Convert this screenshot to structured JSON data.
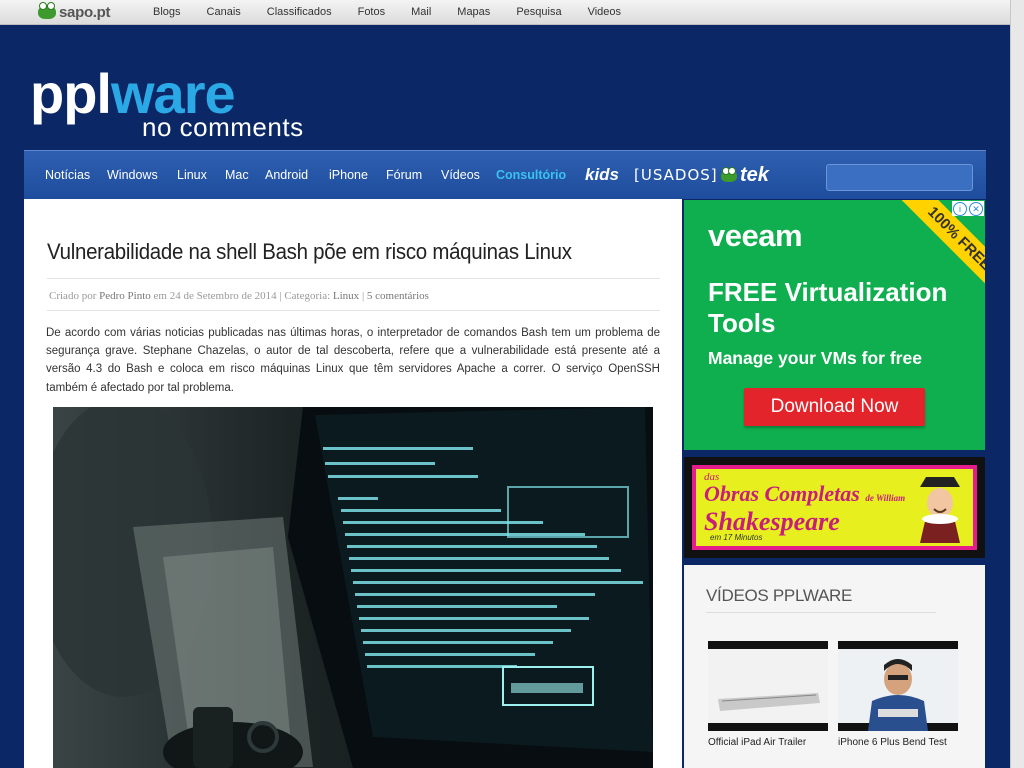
{
  "sapo": {
    "logo_text": "sapo.pt",
    "nav": [
      "Blogs",
      "Canais",
      "Classificados",
      "Fotos",
      "Mail",
      "Mapas",
      "Pesquisa",
      "Videos"
    ]
  },
  "site": {
    "logo_ppl": "ppl",
    "logo_ware": "ware",
    "tagline": "no comments"
  },
  "nav": {
    "items": [
      "Notícias",
      "Windows",
      "Linux",
      "Mac",
      "Android",
      "iPhone",
      "Fórum",
      "Vídeos"
    ],
    "consultorio": "Consultório",
    "kids": "kids",
    "usados": "[USADOS]",
    "tek": "tek"
  },
  "article": {
    "title": "Vulnerabilidade na shell Bash põe em risco máquinas Linux",
    "meta_criado": "Criado por",
    "author": "Pedro Pinto",
    "meta_date": "em 24 de Setembro de 2014 | Categoria:",
    "category": "Linux",
    "comments": "5 comentários",
    "body": "De acordo com várias noticias publicadas nas últimas horas, o interpretador de comandos Bash tem um problema de segurança grave. Stephane Chazelas, o autor de tal descoberta, refere que a vulnerabilidade está presente até a versão 4.3 do Bash e coloca em risco máquinas Linux que têm servidores Apache a correr. O serviço OpenSSH também é afectado por tal problema."
  },
  "ad_veeam": {
    "brand": "veeam",
    "headline": "FREE Virtualization Tools",
    "sub": "Manage your VMs for free",
    "button": "Download Now",
    "ribbon": "100% FREE"
  },
  "ad_shakespeare": {
    "line1": "das",
    "line2": "Obras Completas",
    "line2b": "de William",
    "line3": "Shakespeare",
    "line4": "em 17 Minutos"
  },
  "videos": {
    "heading": "VÍDEOS PPLWARE",
    "items": [
      {
        "caption": "Official iPad Air Trailer"
      },
      {
        "caption": "iPhone 6 Plus Bend Test"
      }
    ]
  }
}
